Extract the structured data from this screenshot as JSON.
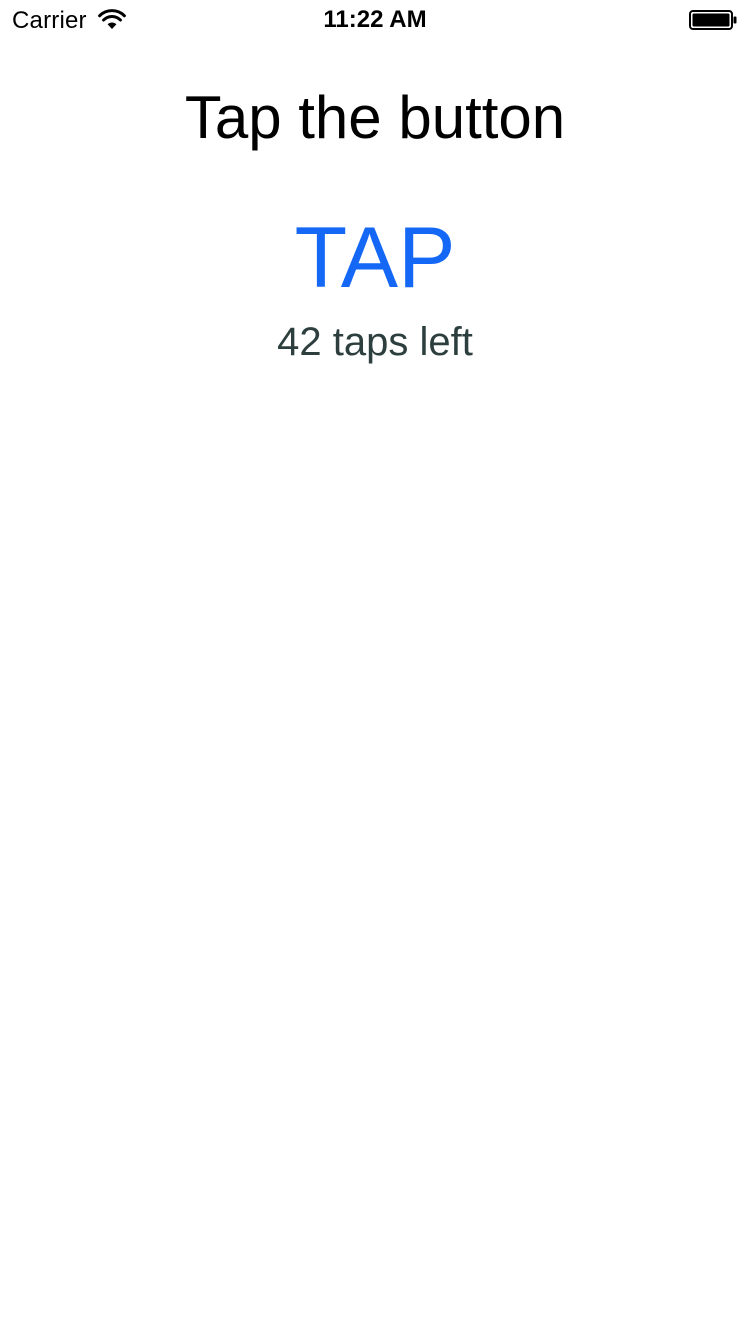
{
  "status_bar": {
    "carrier": "Carrier",
    "time": "11:22 AM",
    "wifi_icon": "wifi-icon",
    "battery_icon": "battery-full-icon",
    "battery_level": 1.0
  },
  "main": {
    "title": "Tap the button",
    "tap_button_label": "TAP",
    "taps_left_text": "42 taps left"
  },
  "colors": {
    "background": "#ffffff",
    "button": "#1468f5",
    "status_text": "#2c3e3d",
    "title": "#000000"
  }
}
